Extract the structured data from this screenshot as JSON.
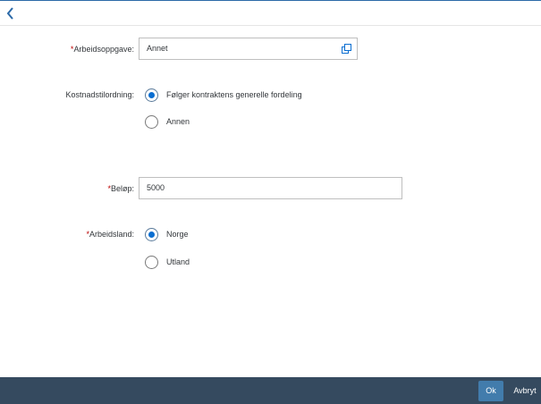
{
  "header": {
    "back_icon": "chevron-left-icon"
  },
  "form": {
    "task": {
      "required_mark": "*",
      "label": "Arbeidsoppgave:",
      "value": "Annet",
      "value_help_icon": "value-help-icon"
    },
    "cost_allocation": {
      "label": "Kostnadstilordning:",
      "options": [
        {
          "label": "Følger kontraktens generelle fordeling",
          "selected": true
        },
        {
          "label": "Annen",
          "selected": false
        }
      ]
    },
    "amount": {
      "required_mark": "*",
      "label": "Beløp:",
      "value": "5000"
    },
    "work_country": {
      "required_mark": "*",
      "label": "Arbeidsland:",
      "options": [
        {
          "label": "Norge",
          "selected": true
        },
        {
          "label": "Utland",
          "selected": false
        }
      ]
    }
  },
  "footer": {
    "ok_label": "Ok",
    "cancel_label": "Avbryt"
  },
  "colors": {
    "footer_bg": "#354a5f",
    "accent": "#0a6ed1",
    "ok_button": "#427cac",
    "required": "#bb0000"
  }
}
